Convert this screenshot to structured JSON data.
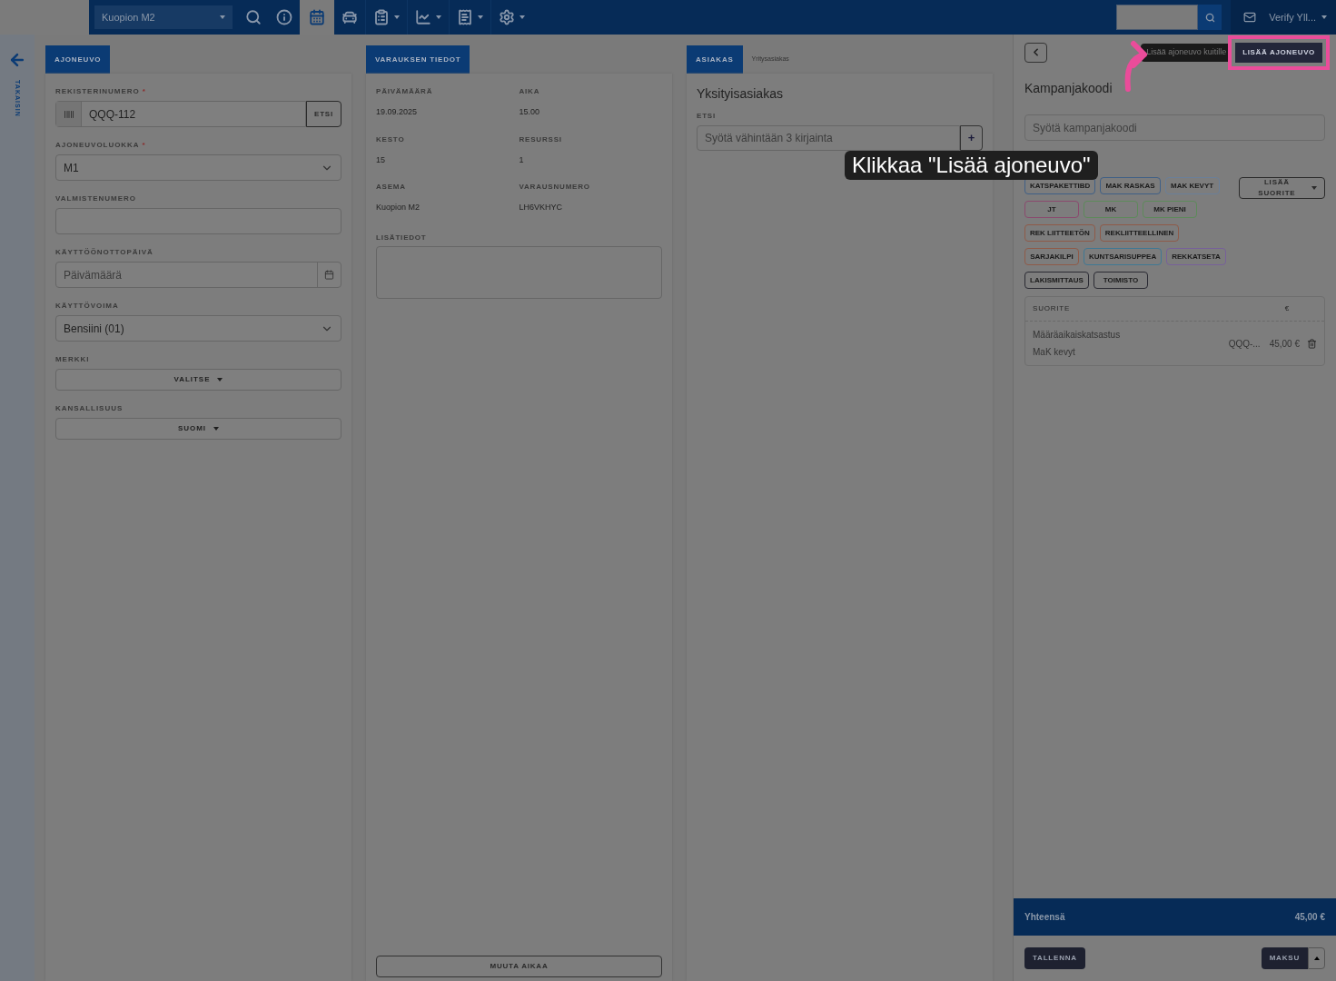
{
  "topbar": {
    "station": "Kuopion M2",
    "nav": [
      {
        "kind": "search",
        "selected": false,
        "caret": false
      },
      {
        "kind": "info",
        "selected": false,
        "caret": false
      },
      {
        "kind": "calendar",
        "selected": true,
        "caret": false
      },
      {
        "kind": "car",
        "selected": false,
        "caret": false
      },
      {
        "kind": "clipboard",
        "selected": false,
        "caret": true
      },
      {
        "kind": "chart",
        "selected": false,
        "caret": true
      },
      {
        "kind": "receipt",
        "selected": false,
        "caret": true
      },
      {
        "kind": "settings",
        "selected": false,
        "caret": true
      }
    ],
    "user": "Verify Yll..."
  },
  "back": {
    "label": "TAKAISIN"
  },
  "vehicle": {
    "tab": "AJONEUVO",
    "fields": [
      {
        "kind": "input-button",
        "label": "REKISTERINUMERO",
        "required_mark": "*",
        "value": "QQQ-112",
        "button": "ETSI"
      },
      {
        "kind": "select",
        "label": "AJONEUVOLUOKKA",
        "required_mark": "*",
        "value": "M1"
      },
      {
        "kind": "input",
        "label": "VALMISTENUMERO"
      },
      {
        "kind": "date",
        "label": "KÄYTTÖÖNOTTOPÄIVÄ",
        "placeholder": "Päivämäärä"
      },
      {
        "kind": "select",
        "label": "KÄYTTÖVOIMA",
        "value": "Bensiini (01)"
      },
      {
        "kind": "dropdown",
        "label": "MERKKI",
        "value": "VALITSE"
      },
      {
        "kind": "dropdown",
        "label": "KANSALLISUUS",
        "value": "SUOMI"
      }
    ]
  },
  "booking": {
    "tab": "VARAUKSEN TIEDOT",
    "items": [
      {
        "label": "PÄIVÄMÄÄRÄ",
        "value": "19.09.2025"
      },
      {
        "label": "AIKA",
        "value": "15.00"
      },
      {
        "label": "KESTO",
        "value": "15"
      },
      {
        "label": "RESURSSI",
        "value": "1"
      },
      {
        "label": "ASEMA",
        "value": "Kuopion M2"
      },
      {
        "label": "VARAUSNUMERO",
        "value": "LH6VKHYC"
      }
    ],
    "notes_label": "LISÄTIEDOT",
    "button": "MUUTA AIKAA"
  },
  "customer": {
    "tabs": [
      {
        "label": "ASIAKAS",
        "selected": true
      },
      {
        "label": "Yritysasiakas",
        "selected": false
      }
    ],
    "heading": "Yksityisasiakas",
    "search_label": "ETSI",
    "search_placeholder": "Syötä vähintään 3 kirjainta",
    "add": "+"
  },
  "receipt": {
    "tooltip": "Lisää ajoneuvo kuitille",
    "add_vehicle": "LISÄÄ AJONEUVO",
    "campaign_heading": "Kampanjakoodi",
    "campaign_placeholder": "Syötä kampanjakoodi",
    "add_service": "LISÄÄ SUORITE",
    "tags": [
      {
        "label": "KATSPAKETTIBD",
        "color": "#3f5f86"
      },
      {
        "label": "MAK RASKAS",
        "color": "#3f5f86"
      },
      {
        "label": "MAK KEVYT",
        "color": "#6a7f99"
      },
      {
        "label": "JT",
        "color": "#8a4a6e"
      },
      {
        "label": "MK",
        "color": "#5d8a5a"
      },
      {
        "label": "MK PIENI",
        "color": "#5d8a5a"
      },
      {
        "label": "REK LIITTEETÖN",
        "color": "#8f5a48"
      },
      {
        "label": "REKLIITTEELLINEN",
        "color": "#8f5a48"
      },
      {
        "label": "SARJAKILPI",
        "color": "#8f5a48"
      },
      {
        "label": "KUNTSARISUPPEA",
        "color": "#3f7894"
      },
      {
        "label": "REKKATSETA",
        "color": "#77609a"
      },
      {
        "label": "LAKISMITTAUS",
        "color": "#2a2a33"
      },
      {
        "label": "TOIMISTO",
        "color": "#2a2a33"
      }
    ],
    "table": {
      "columns": [
        "SUORITE",
        "€"
      ],
      "rows": [
        {
          "name": "Määräaikaiskatsastus",
          "sub": "MaK kevyt",
          "plate": "QQQ-...",
          "price": "45,00 €"
        }
      ]
    },
    "total_label": "Yhteensä",
    "total": "45,00 €",
    "save": "TALLENNA",
    "pay": "MAKSU"
  },
  "callout": {
    "text": "Klikkaa \"Lisää ajoneuvo\""
  }
}
